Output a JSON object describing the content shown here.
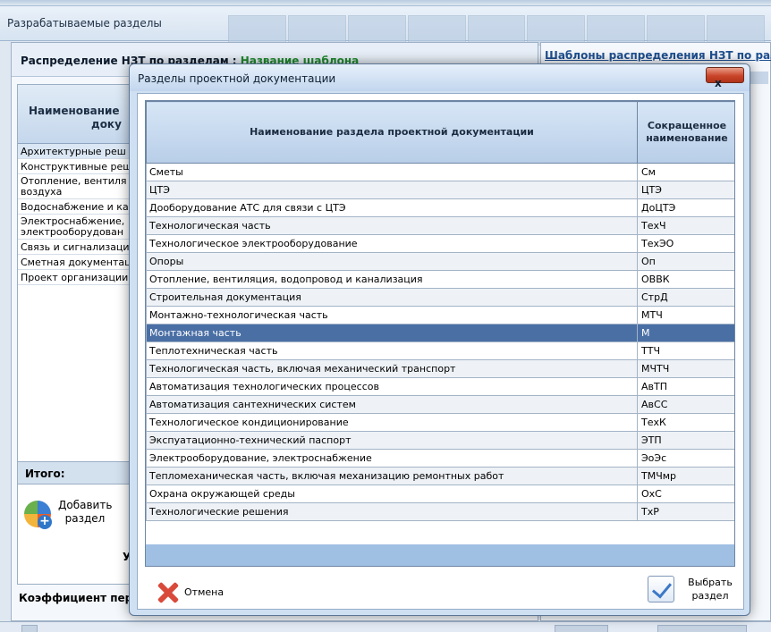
{
  "background": {
    "window_title": "Разрабатываемые разделы",
    "left_header_label": "Распределение НЗТ по  разделам :",
    "template_name": "Название шаблона",
    "column_header_line1": "Наименование",
    "column_header_line2": "доку",
    "rows": [
      "Архитектурные реш",
      "Конструктивные реш",
      "Отопление, вентиля воздуха",
      "Водоснабжение и ка",
      "Электроснабжение, электрооборудован",
      "Связь и сигнализаци",
      "Сметная документац",
      "Проект организации"
    ],
    "total_label": "Итого:",
    "add_button_label": "Добавить раздел",
    "u_label": "У",
    "coef_label": "Коэффициент пер",
    "right_pane_title": "Шаблоны распределения НЗТ по разд"
  },
  "dialog": {
    "title": "Разделы проектной документации",
    "close_label": "x",
    "headers": {
      "name": "Наименование раздела проектной документации",
      "short_line1": "Сокращенное",
      "short_line2": "наименование"
    },
    "rows": [
      {
        "name": "Сметы",
        "short": "См"
      },
      {
        "name": "ЦТЭ",
        "short": "ЦТЭ"
      },
      {
        "name": "Дооборудование АТС для связи с ЦТЭ",
        "short": "ДоЦТЭ"
      },
      {
        "name": "Технологическая часть",
        "short": "ТехЧ"
      },
      {
        "name": "Технологическое электрооборудование",
        "short": "ТехЭО"
      },
      {
        "name": "Опоры",
        "short": "Оп"
      },
      {
        "name": "Отопление, вентиляция, водопровод и канализация",
        "short": "ОВВК"
      },
      {
        "name": "Строительная документация",
        "short": "СтрД"
      },
      {
        "name": "Монтажно-технологическая часть",
        "short": "МТЧ"
      },
      {
        "name": "Монтажная часть",
        "short": "М"
      },
      {
        "name": "Теплотехническая часть",
        "short": "ТТЧ"
      },
      {
        "name": "Технологическая часть, включая механический транспорт",
        "short": "МЧТЧ"
      },
      {
        "name": "Автоматизация технологических процессов",
        "short": "АвТП"
      },
      {
        "name": "Автоматизация сантехнических систем",
        "short": "АвСС"
      },
      {
        "name": "Технологическое кондиционирование",
        "short": "ТехК"
      },
      {
        "name": "Экспуатационно-технический паспорт",
        "short": "ЭТП"
      },
      {
        "name": "Электрооборудование, электроснабжение",
        "short": "ЭоЭс"
      },
      {
        "name": "Тепломеханическая часть, включая механизацию ремонтных работ",
        "short": "ТМЧмр"
      },
      {
        "name": "Охрана окружающей среды",
        "short": "ОхС"
      },
      {
        "name": "Технологические решения",
        "short": "ТхР"
      }
    ],
    "selected_row": "Монтажная часть",
    "cancel_label": "Отмена",
    "select_line1": "Выбрать",
    "select_line2": "раздел"
  },
  "colors": {
    "selection": "#4a6fa5",
    "close_button": "#c9452a",
    "template_name": "#1e8a2d"
  }
}
